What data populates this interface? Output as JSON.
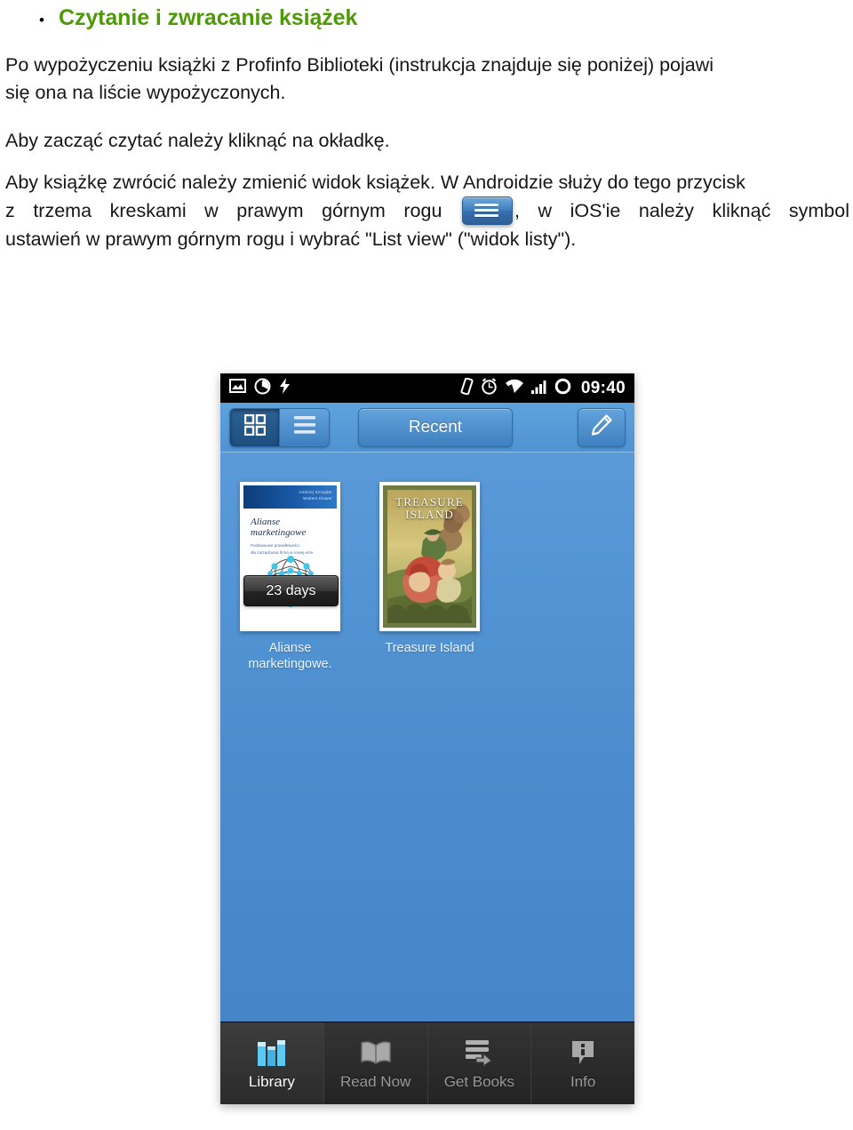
{
  "document": {
    "heading": {
      "bullet": "•",
      "text": "Czytanie i zwracanie książek",
      "color": "#4e9a06"
    },
    "paragraphs": {
      "p1_line1": "Po wypożyczeniu książki z Profinfo Biblioteki (instrukcja znajduje się poniżej) pojawi",
      "p1_line2": "się ona na liście wypożyczonych.",
      "p2": "Aby zacząć czytać należy kliknąć na okładkę.",
      "p3_line1": "Aby książkę zwrócić należy zmienić widok książek. W Androidzie służy do tego przycisk",
      "p3_line2_before": "z trzema kreskami w prawym górnym rogu",
      "p3_line2_after": ", w iOS'ie należy kliknąć symbol",
      "p3_line3": "ustawień    w prawym górnym rogu i wybrać \"List view\" (\"widok listy\")."
    },
    "inline_icon_name": "hamburger-menu-icon"
  },
  "phone": {
    "statusbar": {
      "time": "09:40",
      "left_icons": [
        "image-icon",
        "clock-progress-icon",
        "lightning-icon"
      ],
      "right_icons": [
        "vibrate-icon",
        "alarm-icon",
        "wifi-icon",
        "signal-icon",
        "battery-icon"
      ]
    },
    "toolbar": {
      "grid_view_label": "grid-view",
      "list_view_label": "list-view",
      "recent_label": "Recent",
      "edit_label": "edit",
      "active_view": "grid"
    },
    "library": {
      "books": [
        {
          "title": "Alianse\nmarketingowe.",
          "cover_title": "Alianse marketingowe",
          "cover_subtitle": "Podstawowe prawidłowości\ndla zarządzania firmą w nowej erze",
          "cover_author": "Andrzej Sznajder\nWolters Kluwer",
          "badge": "23 days"
        },
        {
          "title": "Treasure Island",
          "cover_title": "TREASURE\nISLAND",
          "badge": ""
        }
      ]
    },
    "tabs": [
      {
        "label": "Library",
        "icon": "books-shelf-icon",
        "active": true
      },
      {
        "label": "Read Now",
        "icon": "open-book-icon",
        "active": false
      },
      {
        "label": "Get Books",
        "icon": "download-list-icon",
        "active": false
      },
      {
        "label": "Info",
        "icon": "info-bubble-icon",
        "active": false
      }
    ]
  },
  "colors": {
    "heading_green": "#4e9a06",
    "phone_blue": "#4f93d2",
    "toolbar_blue": "#3e7fbe",
    "tabbar_dark": "#2b2b2b"
  }
}
